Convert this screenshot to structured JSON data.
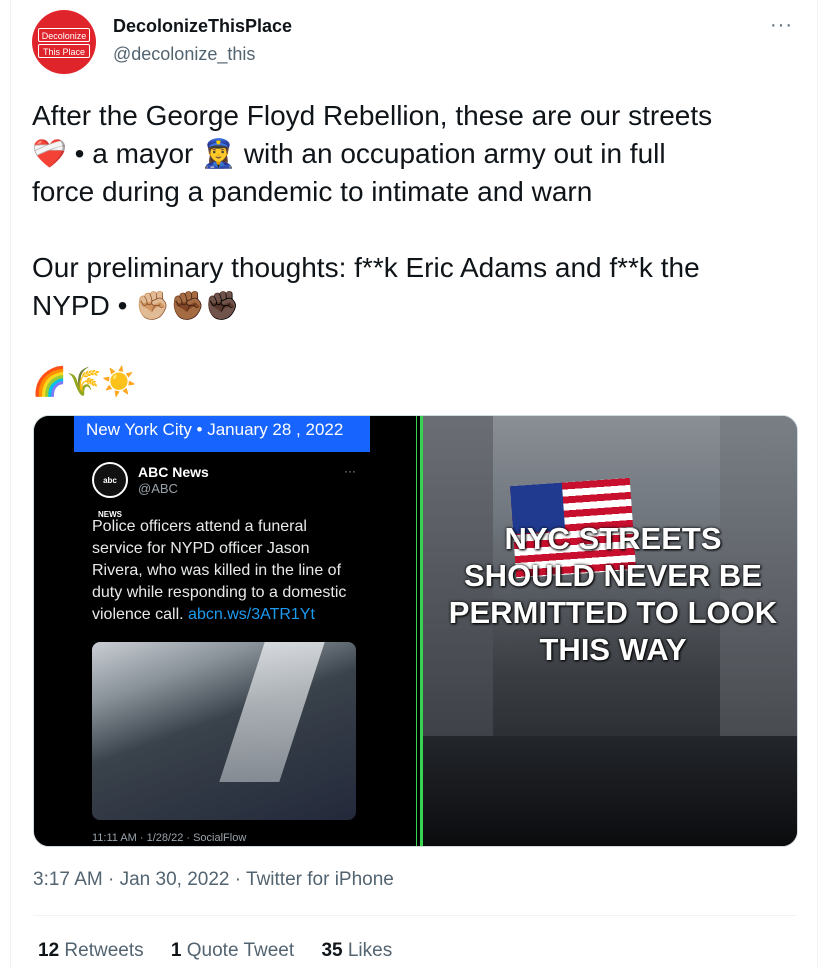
{
  "author": {
    "display_name": "DecolonizeThisPlace",
    "handle": "@decolonize_this",
    "avatar_lines": [
      "Decolonize",
      "This Place"
    ]
  },
  "more_label": "···",
  "tweet": {
    "line1": "After the George Floyd Rebellion, these are our streets",
    "line2_a": "❤️‍🩹",
    "line2_b": " • a mayor ",
    "line2_c": "👮‍♀️",
    "line2_d": " with an occupation army out in full",
    "line3": "force during a pandemic to intimate and warn",
    "line4": "Our preliminary thoughts: f**k Eric Adams and f**k the",
    "line5_a": "NYPD • ",
    "line5_b": "✊🏼✊🏾✊🏿",
    "line6": "🌈🌾☀️"
  },
  "media": {
    "left": {
      "banner": "New York City • January 28 , 2022",
      "abc_logo": "abc NEWS",
      "abc_name": "ABC News",
      "abc_handle": "@ABC",
      "abc_dots": "···",
      "abc_text": "Police officers attend a funeral service for NYPD officer Jason Rivera, who was killed in the line of duty while responding to a domestic violence call. ",
      "abc_link": "abcn.ws/3ATR1Yt",
      "abc_footer": "11:11 AM · 1/28/22 · SocialFlow"
    },
    "right": {
      "overlay": "NYC STREETS SHOULD NEVER BE PERMITTED TO LOOK THIS WAY"
    }
  },
  "meta": {
    "time": "3:17 AM",
    "date": "Jan 30, 2022",
    "source": "Twitter for iPhone"
  },
  "stats": {
    "retweets_count": "12",
    "retweets_label": "Retweets",
    "quotes_count": "1",
    "quotes_label": "Quote Tweet",
    "likes_count": "35",
    "likes_label": "Likes"
  },
  "colors": {
    "avatar_red": "#e0242b",
    "green_border": "#39d353",
    "banner_blue": "#1864ff",
    "link_blue": "#1d9bf0"
  }
}
